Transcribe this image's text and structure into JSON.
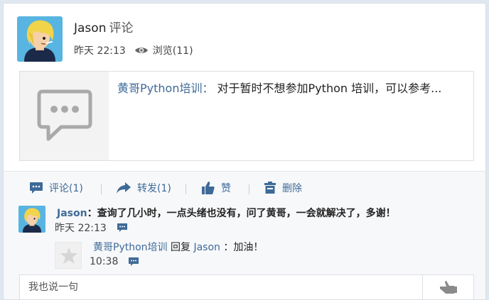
{
  "post": {
    "author": "Jason",
    "action": "评论",
    "time": "昨天 22:13",
    "views": "浏览(11)"
  },
  "quote": {
    "source": "黄哥Python培训：",
    "text": " 对于暂时不想参加Python 培训，可以参考...",
    "icon": "chat-bubble-icon"
  },
  "actions": {
    "comment": "评论(1)",
    "repost": "转发(1)",
    "like": "赞",
    "delete": "删除"
  },
  "comment": {
    "name": "Jason",
    "text": "：查询了几小时，一点头绪也没有，问了黄哥，一会就解决了，多谢！",
    "time": "昨天 22:13"
  },
  "reply": {
    "name": "黄哥Python培训",
    "verb": "回复",
    "target": "Jason",
    "text": "：加油！",
    "time": "10:38"
  },
  "input": {
    "placeholder": "我也说一句"
  },
  "colors": {
    "link": "#3e6a97",
    "background": "#dfe8f1"
  }
}
